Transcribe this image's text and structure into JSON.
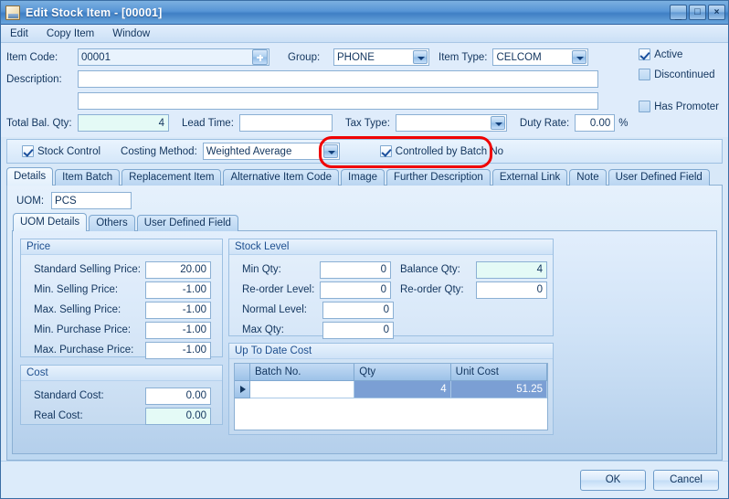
{
  "window": {
    "title": "Edit Stock Item - [00001]",
    "icon": "stock-item-icon",
    "minimize": "_",
    "maximize": "□",
    "close": "×"
  },
  "menu": {
    "items": [
      {
        "label": "Edit"
      },
      {
        "label": "Copy Item"
      },
      {
        "label": "Window"
      }
    ]
  },
  "header": {
    "item_code_label": "Item Code:",
    "item_code_value": "00001",
    "group_label": "Group:",
    "group_value": "PHONE",
    "item_type_label": "Item Type:",
    "item_type_value": "CELCOM",
    "description_label": "Description:",
    "description_line1": "",
    "description_line2": "",
    "total_bal_qty_label": "Total Bal. Qty:",
    "total_bal_qty_value": "4",
    "lead_time_label": "Lead Time:",
    "lead_time_value": "",
    "tax_type_label": "Tax Type:",
    "tax_type_value": "",
    "duty_rate_label": "Duty Rate:",
    "duty_rate_value": "0.00",
    "percent_symbol": "%",
    "active_label": "Active",
    "discontinued_label": "Discontinued",
    "has_promoter_label": "Has Promoter"
  },
  "stock_bar": {
    "stock_control_label": "Stock Control",
    "costing_method_label": "Costing Method:",
    "costing_method_value": "Weighted Average",
    "controlled_by_batch_label": "Controlled by Batch No",
    "highlight_color": "#f00000"
  },
  "main_tabs": [
    {
      "label": "Details",
      "active": true
    },
    {
      "label": "Item Batch",
      "active": false
    },
    {
      "label": "Replacement Item",
      "active": false
    },
    {
      "label": "Alternative Item Code",
      "active": false
    },
    {
      "label": "Image",
      "active": false
    },
    {
      "label": "Further Description",
      "active": false
    },
    {
      "label": "External Link",
      "active": false
    },
    {
      "label": "Note",
      "active": false
    },
    {
      "label": "User Defined Field",
      "active": false
    }
  ],
  "details": {
    "uom_label": "UOM:",
    "uom_value": "PCS"
  },
  "sub_tabs": [
    {
      "label": "UOM Details",
      "active": true
    },
    {
      "label": "Others",
      "active": false
    },
    {
      "label": "User Defined Field",
      "active": false
    }
  ],
  "price_group": {
    "title": "Price",
    "fields": [
      {
        "label": "Standard Selling Price:",
        "value": "20.00",
        "readonly": false
      },
      {
        "label": "Min. Selling Price:",
        "value": "-1.00",
        "readonly": false
      },
      {
        "label": "Max. Selling Price:",
        "value": "-1.00",
        "readonly": false
      },
      {
        "label": "Min. Purchase Price:",
        "value": "-1.00",
        "readonly": false
      },
      {
        "label": "Max. Purchase Price:",
        "value": "-1.00",
        "readonly": false
      }
    ]
  },
  "cost_group": {
    "title": "Cost",
    "fields": [
      {
        "label": "Standard Cost:",
        "value": "0.00",
        "readonly": false
      },
      {
        "label": "Real Cost:",
        "value": "0.00",
        "readonly": true
      }
    ]
  },
  "stock_level_group": {
    "title": "Stock Level",
    "left_fields": [
      {
        "label": "Min Qty:",
        "value": "0",
        "readonly": false
      },
      {
        "label": "Re-order Level:",
        "value": "0",
        "readonly": false
      },
      {
        "label": "Normal Level:",
        "value": "0",
        "readonly": false
      },
      {
        "label": "Max Qty:",
        "value": "0",
        "readonly": false
      }
    ],
    "right_fields": [
      {
        "label": "Balance Qty:",
        "value": "4",
        "readonly": true
      },
      {
        "label": "Re-order Qty:",
        "value": "0",
        "readonly": false
      }
    ]
  },
  "up_to_date_cost": {
    "title": "Up To Date Cost",
    "columns": [
      "Batch No.",
      "Qty",
      "Unit Cost"
    ],
    "rows": [
      {
        "batch_no": "",
        "qty": "4",
        "unit_cost": "51.25",
        "selected": true
      }
    ]
  },
  "footer": {
    "ok_label": "OK",
    "cancel_label": "Cancel"
  }
}
